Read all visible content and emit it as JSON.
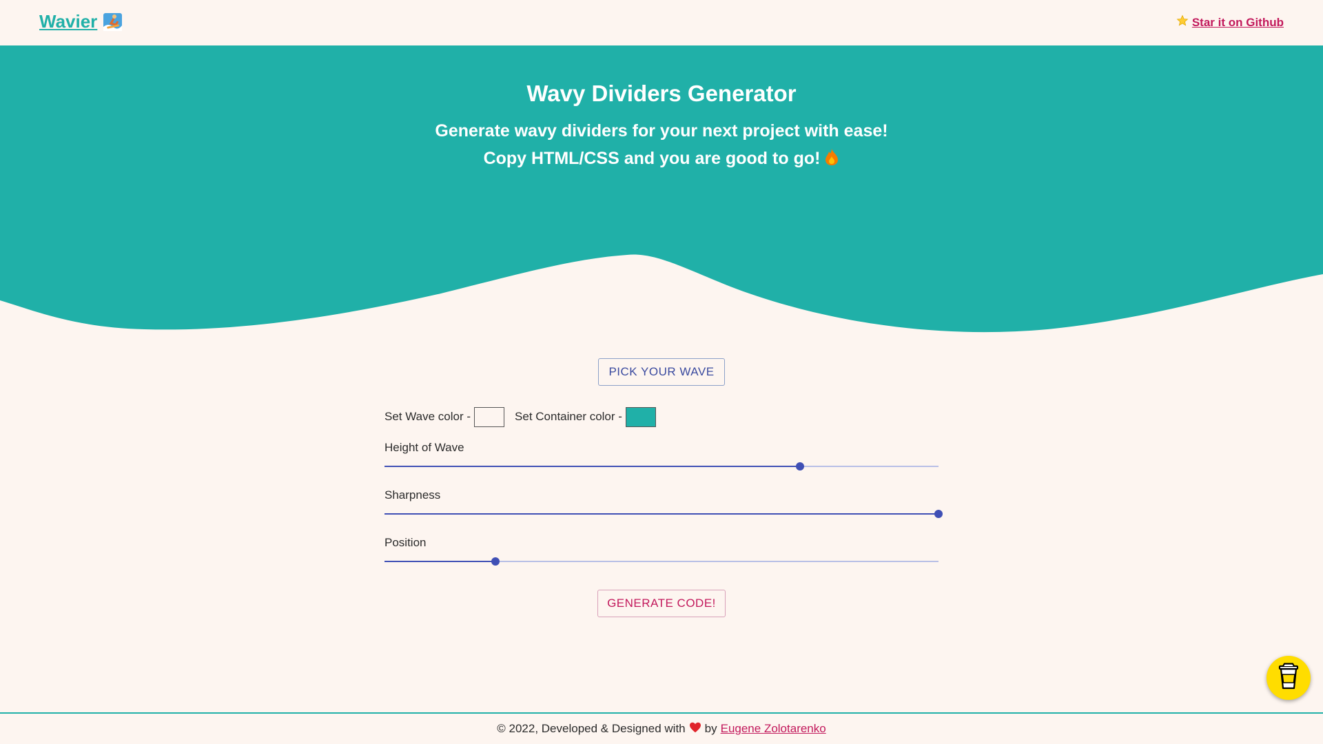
{
  "header": {
    "logo_text": "Wavier",
    "logo_icon": "surfer-icon",
    "github_link": "Star it on Github",
    "github_icon": "star-icon"
  },
  "hero": {
    "title": "Wavy Dividers Generator",
    "subtitle_line1": "Generate wavy dividers for your next project with ease!",
    "subtitle_line2": "Copy HTML/CSS and you are good to go!",
    "subtitle_icon": "fire-icon",
    "background_color": "#20b0a8"
  },
  "controls": {
    "pick_wave_button": "PICK YOUR WAVE",
    "wave_color_label": "Set Wave color -",
    "wave_color_value": "#fdf5f0",
    "container_color_label": "Set Container color -",
    "container_color_value": "#20b0a8",
    "sliders": [
      {
        "label": "Height of Wave",
        "value": 0.75
      },
      {
        "label": "Sharpness",
        "value": 1.0
      },
      {
        "label": "Position",
        "value": 0.2
      }
    ],
    "generate_button": "GENERATE CODE!"
  },
  "footer": {
    "text_before": "© 2022, Developed & Designed with",
    "heart_icon": "heart-icon",
    "by_text": "by",
    "author_link": "Eugene Zolotarenko"
  },
  "floating": {
    "coffee_icon": "coffee-cup-icon"
  },
  "colors": {
    "accent_teal": "#20b0a8",
    "accent_pink": "#c2185b",
    "slider_blue": "#3f4fb5",
    "page_bg": "#fdf5f0",
    "coffee_yellow": "#ffdd00"
  }
}
